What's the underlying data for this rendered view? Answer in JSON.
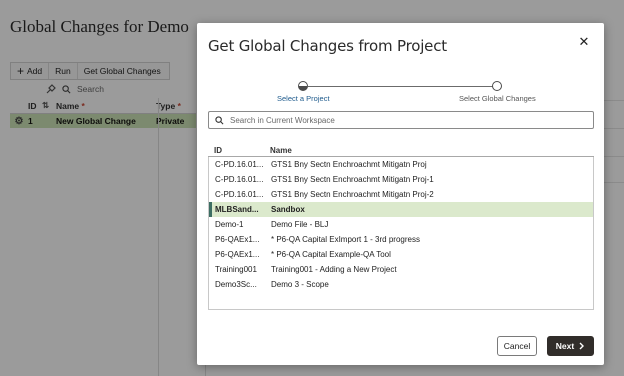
{
  "background": {
    "title": "Global Changes for Demo",
    "toolbar": {
      "add": "Add",
      "run": "Run",
      "get_global_changes": "Get Global Changes"
    },
    "search_placeholder": "Search",
    "columns": {
      "id": "ID",
      "name": "Name",
      "type": "Type"
    },
    "required_mark": "*",
    "row": {
      "id": "1",
      "name": "New Global Change",
      "type": "Private"
    }
  },
  "dialog": {
    "title": "Get Global Changes from Project",
    "close_glyph": "✕",
    "steps": [
      {
        "label": "Select a Project",
        "active": true
      },
      {
        "label": "Select Global Changes",
        "active": false
      }
    ],
    "search_placeholder": "Search in Current Workspace",
    "columns": {
      "id": "ID",
      "name": "Name"
    },
    "rows": [
      {
        "id": "C-PD.16.01...",
        "name": "GTS1 Bny Sectn Enchroachmt Mitigatn Proj",
        "selected": false
      },
      {
        "id": "C-PD.16.01...",
        "name": "GTS1 Bny Sectn Enchroachmt Mitigatn Proj-1",
        "selected": false
      },
      {
        "id": "C-PD.16.01...",
        "name": "GTS1 Bny Sectn Enchroachmt Mitigatn Proj-2",
        "selected": false
      },
      {
        "id": "MLBSand...",
        "name": "Sandbox",
        "selected": true
      },
      {
        "id": "Demo-1",
        "name": "Demo File - BLJ",
        "selected": false
      },
      {
        "id": "P6-QAEx1...",
        "name": "* P6-QA Capital ExImport 1 - 3rd progress",
        "selected": false
      },
      {
        "id": "P6-QAEx1...",
        "name": "* P6-QA Capital Example-QA Tool",
        "selected": false
      },
      {
        "id": "Training001",
        "name": "Training001 - Adding a New Project",
        "selected": false
      },
      {
        "id": "Demo3Sc...",
        "name": "Demo 3 - Scope",
        "selected": false
      }
    ],
    "buttons": {
      "cancel": "Cancel",
      "next": "Next"
    },
    "colors": {
      "selected_row": "#dbe9cc",
      "primary_button": "#312d2a",
      "active_step": "#1e5a8c"
    }
  }
}
